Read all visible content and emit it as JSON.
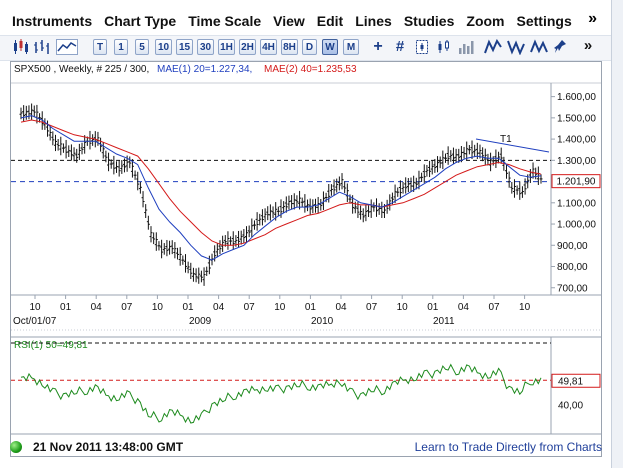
{
  "menu": {
    "items": [
      "Instruments",
      "Chart Type",
      "Time Scale",
      "View",
      "Edit",
      "Lines",
      "Studies",
      "Zoom",
      "Settings"
    ],
    "more": "»"
  },
  "toolbar": {
    "timeframes": [
      "T",
      "1",
      "5",
      "10",
      "15",
      "30",
      "1H",
      "2H",
      "4H",
      "8H",
      "D",
      "W",
      "M"
    ],
    "active_timeframe": "W",
    "more": "»"
  },
  "chart": {
    "header": {
      "symbol": "SPX500 , Weekly, # 225 / 300,",
      "mae1": "MAE(1) 20=1.227,34,",
      "mae2": "MAE(2) 40=1.235,53"
    },
    "price_badge": "1.201,90",
    "annotation": "T1",
    "x_month_ticks": [
      "10",
      "01",
      "04",
      "07",
      "10",
      "01",
      "04",
      "07",
      "10",
      "01",
      "04",
      "07",
      "10",
      "01",
      "04",
      "07",
      "10"
    ],
    "x_year_labels": [
      "Oct/01/07",
      "2009",
      "2010",
      "2011"
    ],
    "y_ticks": [
      "1.600,00",
      "1.500,00",
      "1.400,00",
      "1.300,00",
      "1.200,00",
      "1.100,00",
      "1.000,00",
      "900,00",
      "800,00",
      "700,00"
    ],
    "colors": {
      "price": "#111111",
      "mae1": "#1f3fbf",
      "mae2": "#d41a1a",
      "trendline": "#1f3fbf",
      "badge_border": "#d41a1a",
      "rsi_line": "#1d8a1d",
      "rsi_level": "#d41a1a"
    }
  },
  "rsi": {
    "header": "RSI(1) 50=49,81",
    "value_badge": "49,81",
    "y_tick": "40,00"
  },
  "status": {
    "datetime": "21 Nov 2011 13:48:00 GMT",
    "link": "Learn to Trade Directly from Charts"
  },
  "chart_data": {
    "type": "line",
    "series": [
      {
        "name": "SPX500",
        "x": [
          "Oct/07",
          "Nov/07",
          "Dec/07",
          "Jan/08",
          "Feb/08",
          "Mar/08",
          "Apr/08",
          "May/08",
          "Jun/08",
          "Jul/08",
          "Aug/08",
          "Sep/08",
          "Oct/08",
          "Nov/08",
          "Dec/08",
          "Jan/09",
          "Feb/09",
          "Mar/09",
          "Apr/09",
          "May/09",
          "Jun/09",
          "Jul/09",
          "Aug/09",
          "Sep/09",
          "Oct/09",
          "Nov/09",
          "Dec/09",
          "Jan/10",
          "Feb/10",
          "Mar/10",
          "Apr/10",
          "May/10",
          "Jun/10",
          "Jul/10",
          "Aug/10",
          "Sep/10",
          "Oct/10",
          "Nov/10",
          "Dec/10",
          "Jan/11",
          "Feb/11",
          "Mar/11",
          "Apr/11",
          "May/11",
          "Jun/11",
          "Jul/11",
          "Aug/11",
          "Sep/11",
          "Oct/11",
          "Nov/11"
        ],
        "values": [
          1520,
          1530,
          1470,
          1380,
          1350,
          1320,
          1390,
          1400,
          1290,
          1260,
          1290,
          1170,
          950,
          880,
          890,
          830,
          760,
          750,
          860,
          920,
          920,
          950,
          1010,
          1050,
          1060,
          1100,
          1110,
          1080,
          1090,
          1160,
          1200,
          1090,
          1040,
          1080,
          1060,
          1140,
          1180,
          1190,
          1250,
          1280,
          1320,
          1320,
          1350,
          1340,
          1290,
          1320,
          1170,
          1150,
          1250,
          1200
        ]
      },
      {
        "name": "MAE(1) 20",
        "values": [
          1500,
          1510,
          1490,
          1450,
          1420,
          1390,
          1390,
          1390,
          1360,
          1330,
          1310,
          1280,
          1170,
          1070,
          1010,
          960,
          900,
          850,
          830,
          860,
          880,
          900,
          950,
          990,
          1030,
          1060,
          1080,
          1080,
          1090,
          1120,
          1150,
          1130,
          1100,
          1090,
          1080,
          1100,
          1130,
          1160,
          1190,
          1220,
          1260,
          1290,
          1310,
          1320,
          1310,
          1310,
          1270,
          1230,
          1220,
          1227
        ]
      },
      {
        "name": "MAE(2) 40",
        "values": [
          1480,
          1490,
          1480,
          1460,
          1440,
          1420,
          1410,
          1400,
          1380,
          1360,
          1340,
          1320,
          1260,
          1190,
          1120,
          1060,
          1010,
          960,
          920,
          900,
          900,
          910,
          930,
          950,
          980,
          1000,
          1020,
          1040,
          1050,
          1070,
          1090,
          1100,
          1090,
          1090,
          1080,
          1090,
          1100,
          1120,
          1140,
          1170,
          1200,
          1230,
          1250,
          1270,
          1280,
          1290,
          1280,
          1260,
          1245,
          1235
        ]
      }
    ],
    "hlines": [
      1300,
      1200
    ],
    "ylim": [
      680,
      1650
    ],
    "rsi": {
      "name": "RSI(1) 50",
      "values": [
        50,
        51,
        49,
        45,
        44,
        45,
        46,
        47,
        44,
        43,
        44,
        42,
        36,
        35,
        37,
        36,
        34,
        35,
        40,
        42,
        44,
        45,
        46,
        47,
        46,
        47,
        48,
        48,
        47,
        48,
        50,
        45,
        44,
        46,
        46,
        48,
        50,
        51,
        52,
        53,
        55,
        54,
        55,
        53,
        52,
        53,
        47,
        45,
        50,
        49.81
      ],
      "levels": [
        50
      ],
      "ylim": [
        30,
        65
      ]
    }
  }
}
